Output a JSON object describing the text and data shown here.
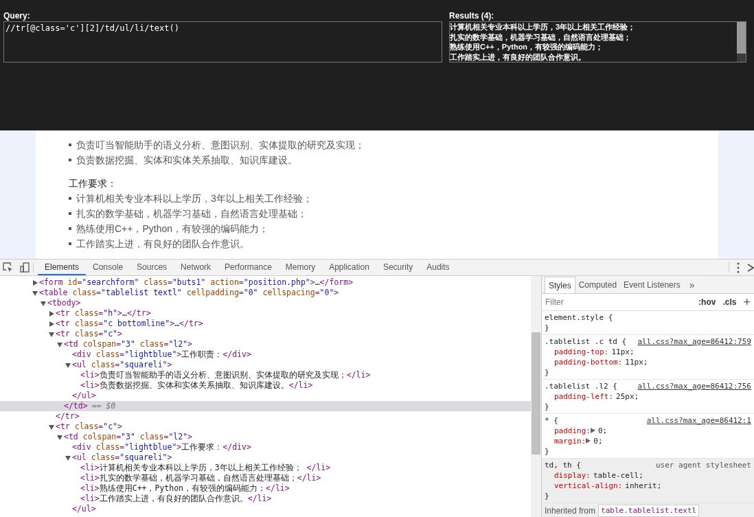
{
  "xpath_helper": {
    "query_label": "Query:",
    "query": "//tr[@class='c'][2]/td/ul/li/text()",
    "results_label": "Results (4):",
    "results": [
      "计算机相关专业本科以上学历，3年以上相关工作经验；",
      "扎实的数学基础，机器学习基础，自然语言处理基础；",
      "熟练使用C++，Python，有较强的编码能力；",
      "工作踏实上进，有良好的团队合作意识。"
    ]
  },
  "page": {
    "sections": [
      {
        "items": [
          "负责叮当智能助手的语义分析、意图识别、实体提取的研究及实现；",
          "负责数据挖掘、实体和实体关系抽取、知识库建设。"
        ]
      },
      {
        "heading": "工作要求：",
        "items": [
          "计算机相关专业本科以上学历，3年以上相关工作经验；",
          "扎实的数学基础，机器学习基础，自然语言处理基础；",
          "熟练使用C++，Python，有较强的编码能力；",
          "工作踏实上进，有良好的团队合作意识。"
        ]
      }
    ]
  },
  "devtools": {
    "tabs": [
      {
        "label": "Elements",
        "selected": true
      },
      {
        "label": "Console",
        "selected": false
      },
      {
        "label": "Sources",
        "selected": false
      },
      {
        "label": "Network",
        "selected": false
      },
      {
        "label": "Performance",
        "selected": false
      },
      {
        "label": "Memory",
        "selected": false
      },
      {
        "label": "Application",
        "selected": false
      },
      {
        "label": "Security",
        "selected": false
      },
      {
        "label": "Audits",
        "selected": false
      }
    ],
    "dom_tree": [
      {
        "line": "<form id=\"searchform\" class=\"buts1\" action=\"position.php\">…</form>",
        "expanded": false
      },
      {
        "line": "<table class=\"tablelist textl\" cellpadding=\"0\" cellspacing=\"0\">",
        "expanded": true,
        "children": [
          {
            "line": "<tbody>",
            "expanded": true,
            "children": [
              {
                "line": "<tr class=\"h\">…</tr>",
                "expanded": false
              },
              {
                "line": "<tr class=\"c bottomline\">…</tr>",
                "expanded": false
              },
              {
                "line": "<tr class=\"c\">",
                "expanded": true,
                "close": "</tr>",
                "children": [
                  {
                    "line": "<td colspan=\"3\" class=\"l2\">",
                    "expanded": true,
                    "close": "</td>",
                    "marker": "== $0",
                    "selected": true,
                    "children": [
                      {
                        "line": "<div class=\"lightblue\">工作职责：</div>"
                      },
                      {
                        "line": "<ul class=\"squareli\">",
                        "expanded": true,
                        "close": "</ul>",
                        "children": [
                          {
                            "line": "<li>负责叮当智能助手的语义分析、意图识别、实体提取的研究及实现；</li>"
                          },
                          {
                            "line": "<li>负责数据挖掘、实体和实体关系抽取、知识库建设。</li>"
                          }
                        ]
                      }
                    ]
                  }
                ]
              },
              {
                "line": "<tr class=\"c\">",
                "expanded": true,
                "children": [
                  {
                    "line": "<td colspan=\"3\" class=\"l2\">",
                    "expanded": true,
                    "children": [
                      {
                        "line": "<div class=\"lightblue\">工作要求：</div>"
                      },
                      {
                        "line": "<ul class=\"squareli\">",
                        "expanded": true,
                        "close": "</ul>",
                        "children": [
                          {
                            "line": "<li>计算机相关专业本科以上学历，3年以上相关工作经验；  </li>"
                          },
                          {
                            "line": "<li>扎实的数学基础，机器学习基础，自然语言处理基础；</li>"
                          },
                          {
                            "line": "<li>熟练使用C++，Python，有较强的编码能力；</li>"
                          },
                          {
                            "line": "<li>工作踏实上进，有良好的团队合作意识。</li>"
                          }
                        ]
                      }
                    ]
                  }
                ]
              }
            ]
          }
        ]
      }
    ],
    "styles_pane": {
      "tabs": [
        {
          "label": "Styles",
          "selected": true
        },
        {
          "label": "Computed",
          "selected": false
        },
        {
          "label": "Event Listeners",
          "selected": false
        }
      ],
      "more": "»",
      "filter_placeholder": "Filter",
      "hov": ":hov",
      "cls": ".cls",
      "add": "+",
      "rules": [
        {
          "selector": "element.style {",
          "close": "}"
        },
        {
          "selector": ".tablelist .c td {",
          "source": "all.css?max_age=86412:759",
          "declarations": [
            {
              "property": "padding-top:",
              "value": "11px;"
            },
            {
              "property": "padding-bottom:",
              "value": "11px;"
            }
          ],
          "close": "}"
        },
        {
          "selector": ".tablelist .l2 {",
          "source": "all.css?max_age=86412:756",
          "declarations": [
            {
              "property": "padding-left:",
              "value": "25px;"
            }
          ],
          "close": "}"
        },
        {
          "selector": "* {",
          "source": "all.css?max_age=86412:1",
          "declarations": [
            {
              "property": "padding:",
              "value": "0;",
              "expandable": true
            },
            {
              "property": "margin:",
              "value": "0;",
              "expandable": true
            }
          ],
          "close": "}"
        },
        {
          "selector": "td, th {",
          "source": "user agent stylesheet",
          "user_agent": true,
          "declarations": [
            {
              "property": "display:",
              "value": "table-cell;"
            },
            {
              "property": "vertical-align:",
              "value": "inherit;"
            }
          ],
          "close": "}"
        }
      ],
      "inherited_label": "Inherited from",
      "inherited_selector": "table.tablelist.textl"
    }
  }
}
